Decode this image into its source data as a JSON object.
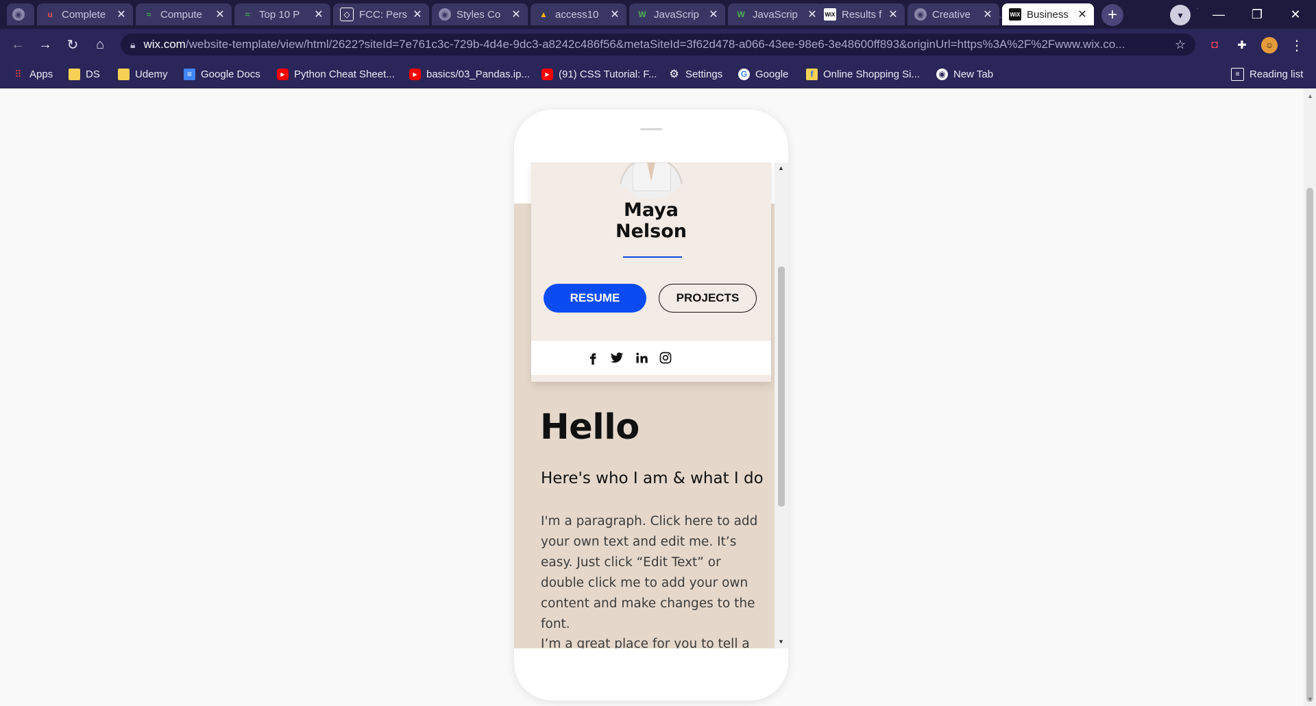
{
  "tabs": [
    {
      "title": "Complete",
      "favicon": "udemy-icon",
      "active": false
    },
    {
      "title": "Compute",
      "favicon": "leetcode-icon",
      "active": false
    },
    {
      "title": "Top 10 P",
      "favicon": "leetcode-icon",
      "active": false
    },
    {
      "title": "FCC: Pers",
      "favicon": "codepen-icon",
      "active": false
    },
    {
      "title": "Styles Co",
      "favicon": "globe-icon",
      "active": false
    },
    {
      "title": "access10",
      "favicon": "google-drive-icon",
      "active": false
    },
    {
      "title": "JavaScrip",
      "favicon": "w3schools-icon",
      "active": false
    },
    {
      "title": "JavaScrip",
      "favicon": "w3schools-icon",
      "active": false
    },
    {
      "title": "Results f",
      "favicon": "wix-icon",
      "active": false
    },
    {
      "title": "Creative",
      "favicon": "globe-icon",
      "active": false
    },
    {
      "title": "Business",
      "favicon": "wix-icon",
      "active": true
    }
  ],
  "address": {
    "host": "wix.com",
    "path": "/website-template/view/html/2622?siteId=7e761c3c-729b-4d4e-9dc3-a8242c486f56&metaSiteId=3f62d478-a066-43ee-98e6-3e48600ff893&originUrl=https%3A%2F%2Fwww.wix.co..."
  },
  "bookmarks": [
    {
      "label": "Apps",
      "icon": "apps-grid-icon"
    },
    {
      "label": "DS",
      "icon": "folder-icon"
    },
    {
      "label": "Udemy",
      "icon": "folder-icon"
    },
    {
      "label": "Google Docs",
      "icon": "google-docs-icon"
    },
    {
      "label": "Python Cheat Sheet...",
      "icon": "youtube-icon"
    },
    {
      "label": "basics/03_Pandas.ip...",
      "icon": "youtube-icon"
    },
    {
      "label": "(91) CSS Tutorial: F...",
      "icon": "youtube-icon"
    },
    {
      "label": "Settings",
      "icon": "gear-icon"
    },
    {
      "label": "Google",
      "icon": "google-icon"
    },
    {
      "label": "Online Shopping Si...",
      "icon": "flipkart-icon"
    },
    {
      "label": "New Tab",
      "icon": "globe-icon"
    }
  ],
  "reading_list": "Reading list",
  "profile": {
    "name": "Maya Nelson",
    "name_line1": "Maya",
    "name_line2": "Nelson",
    "resume_label": "RESUME",
    "projects_label": "PROJECTS",
    "socials": [
      "facebook-icon",
      "twitter-icon",
      "linkedin-icon",
      "instagram-icon"
    ]
  },
  "content": {
    "heading": "Hello",
    "subheading": "Here's who I am & what I do",
    "paragraph": "I'm a paragraph. Click here to add your own text and edit me. It’s easy. Just click “Edit Text” or double click me to add your own content and make changes to the font.",
    "paragraph2_partial": "I’m a great place for you to tell a"
  },
  "colors": {
    "accent": "#0b4cf2",
    "card_bg": "#f3ebe5",
    "section_bg": "#e5d8cb",
    "chrome_bg": "#2a2659"
  }
}
